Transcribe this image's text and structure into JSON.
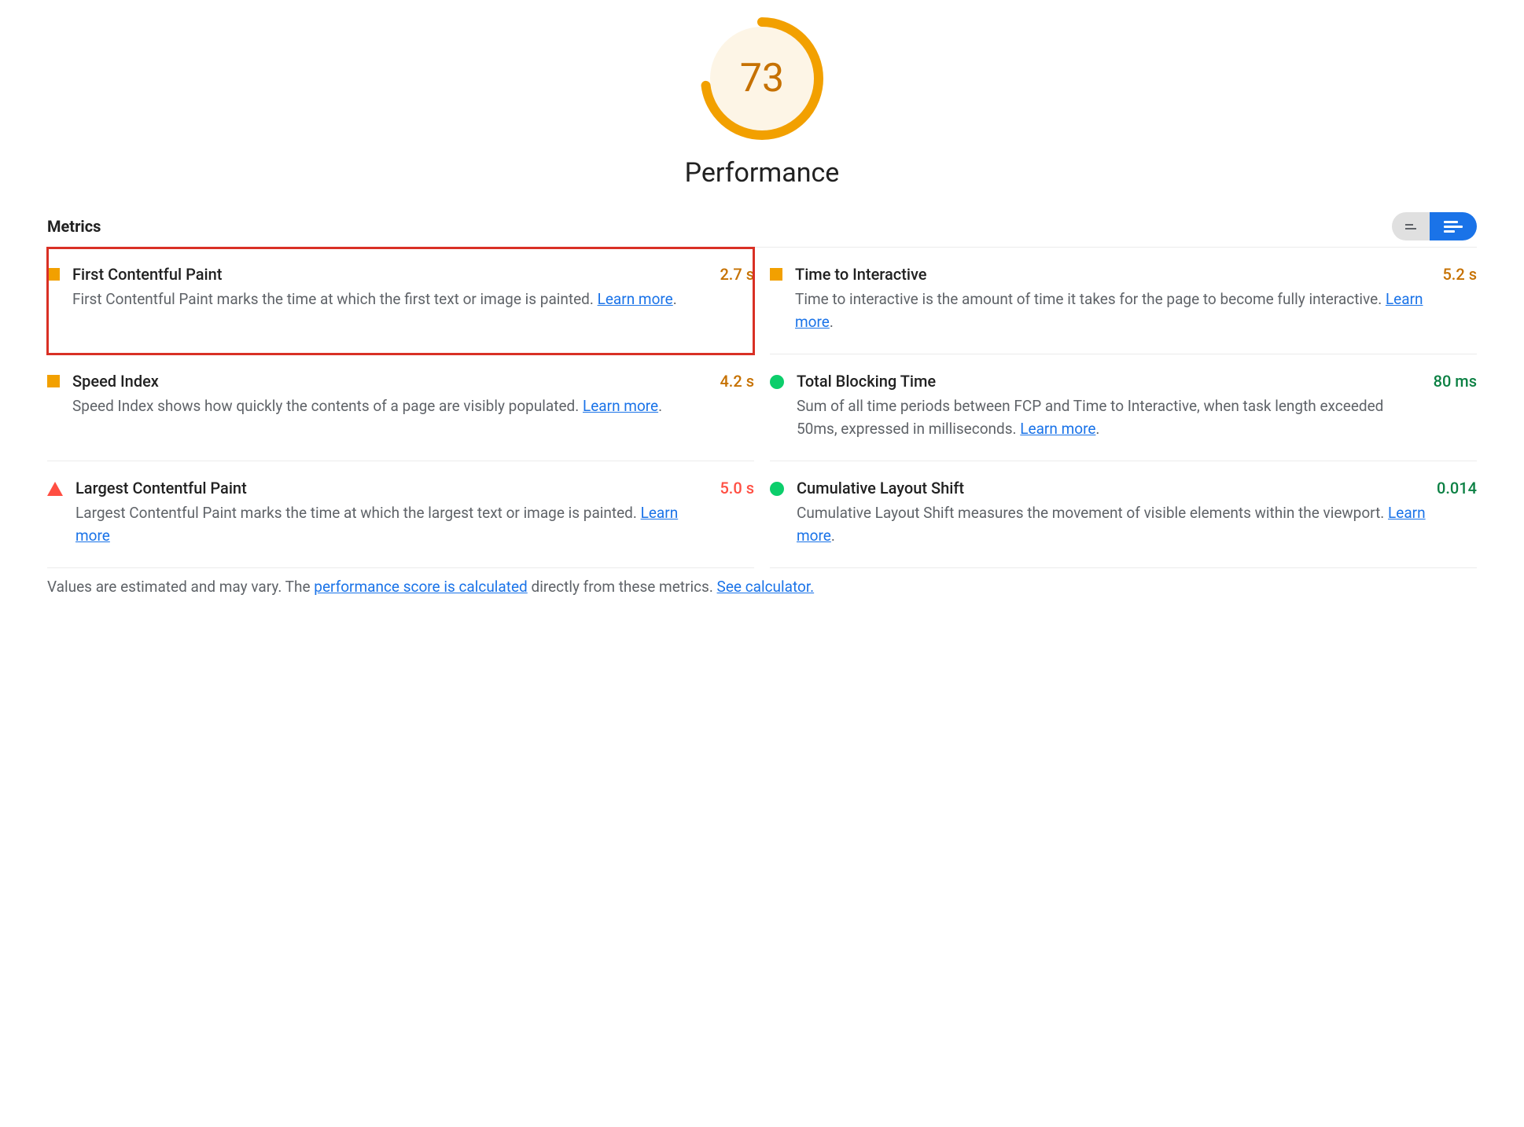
{
  "gauge": {
    "score": "73",
    "score_pct": 73,
    "title": "Performance",
    "color": "#f2a000"
  },
  "metrics_header": {
    "title": "Metrics"
  },
  "metrics": [
    {
      "status": "square",
      "title": "First Contentful Paint",
      "desc": "First Contentful Paint marks the time at which the first text or image is painted. ",
      "learn": "Learn more",
      "value": "2.7 s",
      "value_class": "val-orange",
      "highlight": true,
      "learn_period": "."
    },
    {
      "status": "square",
      "title": "Time to Interactive",
      "desc": "Time to interactive is the amount of time it takes for the page to become fully interactive. ",
      "learn": "Learn more",
      "value": "5.2 s",
      "value_class": "val-orange",
      "highlight": false,
      "learn_period": "."
    },
    {
      "status": "square",
      "title": "Speed Index",
      "desc": "Speed Index shows how quickly the contents of a page are visibly populated. ",
      "learn": "Learn more",
      "value": "4.2 s",
      "value_class": "val-orange",
      "highlight": false,
      "learn_period": "."
    },
    {
      "status": "circle",
      "title": "Total Blocking Time",
      "desc": "Sum of all time periods between FCP and Time to Interactive, when task length exceeded 50ms, expressed in milliseconds. ",
      "learn": "Learn more",
      "value": "80 ms",
      "value_class": "val-green",
      "highlight": false,
      "learn_period": "."
    },
    {
      "status": "triangle",
      "title": "Largest Contentful Paint",
      "desc": "Largest Contentful Paint marks the time at which the largest text or image is painted. ",
      "learn": "Learn more",
      "value": "5.0 s",
      "value_class": "val-red",
      "highlight": false,
      "learn_period": ""
    },
    {
      "status": "circle",
      "title": "Cumulative Layout Shift",
      "desc": "Cumulative Layout Shift measures the movement of visible elements within the viewport. ",
      "learn": "Learn more",
      "value": "0.014",
      "value_class": "val-green",
      "highlight": false,
      "learn_period": "."
    }
  ],
  "footer": {
    "prefix": "Values are estimated and may vary. The ",
    "link1": "performance score is calculated",
    "mid": " directly from these metrics. ",
    "link2": "See calculator."
  }
}
